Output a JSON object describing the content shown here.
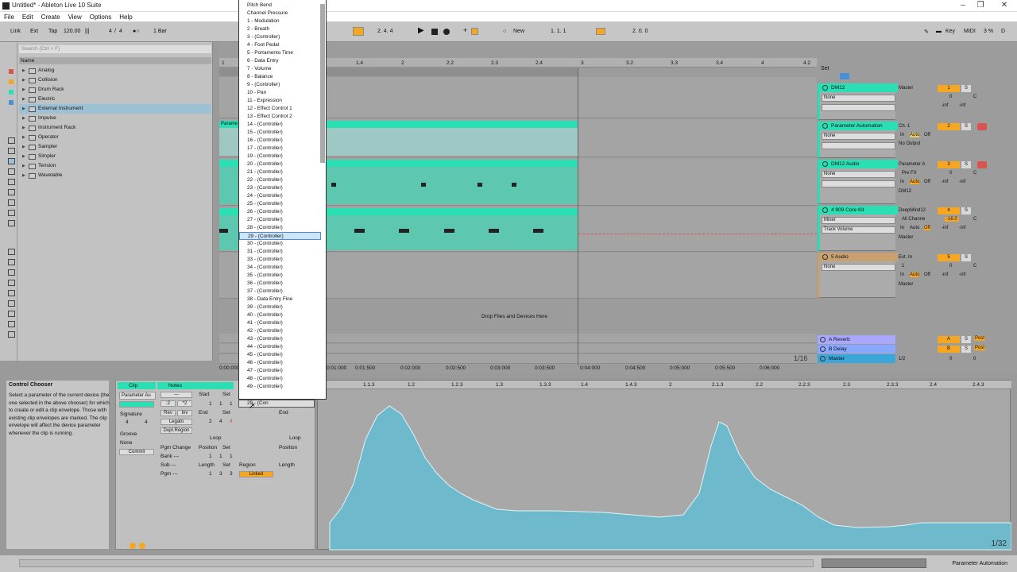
{
  "window": {
    "title": "Untitled* - Ableton Live 10 Suite"
  },
  "menu": [
    "File",
    "Edit",
    "Create",
    "View",
    "Options",
    "Help"
  ],
  "transport": {
    "link": "Link",
    "ext": "Ext",
    "tap": "Tap",
    "tempo": "120.00",
    "meter_num": "4",
    "meter_den": "4",
    "quantize": "1 Bar",
    "pos": "2.  4.  4",
    "new": "New",
    "loop_start": "1.  1.  1",
    "loop_len": "2.  0.  0",
    "key": "Key",
    "midi": "MIDI",
    "cpu": "3 %",
    "d": "D"
  },
  "browser": {
    "search_placeholder": "Search (Ctrl + F)",
    "name_header": "Name",
    "items": [
      "Analog",
      "Collision",
      "Drum Rack",
      "Electric",
      "External Instrument",
      "Impulse",
      "Instrument Rack",
      "Operator",
      "Sampler",
      "Simpler",
      "Tension",
      "Wavetable"
    ],
    "selected": "External Instrument"
  },
  "arrangement": {
    "ruler": [
      "1",
      "1.4",
      "2",
      "2.2",
      "2.3",
      "2.4",
      "3",
      "3.2",
      "3.3",
      "3.4",
      "4",
      "4.2"
    ],
    "times": [
      "0:00:000",
      "0:01:000",
      "0:01:500",
      "0:02:000",
      "0:02:500",
      "0:03:000",
      "0:03:500",
      "0:04:000",
      "0:04:500",
      "0:05:000",
      "0:05:500",
      "0:06:000"
    ],
    "drop_text": "Drop Files and Devices Here",
    "zoom": "1/16",
    "clip_label": "Parame"
  },
  "mixer": {
    "set": "Set",
    "tracks": [
      {
        "name": "DM12",
        "chooser": "None",
        "routing": "Master",
        "num": "1",
        "vol": "0",
        "pan": "C",
        "l": "-inf",
        "r": "-inf"
      },
      {
        "name": "Parameter Automation",
        "chooser": "None",
        "ch": "Ch. 1",
        "in": "In",
        "auto": "Auto",
        "off": "Off",
        "out": "No Output",
        "num": "2"
      },
      {
        "name": "DM12 Audio",
        "chooser": "None",
        "routing": "Parameter A",
        "prefx": "Pre FX",
        "in": "In",
        "auto": "Auto",
        "off": "Off",
        "out": "DM12",
        "num": "3",
        "vol": "0",
        "pan": "C",
        "l": "-inf",
        "r": "-inf"
      },
      {
        "name": "4 909 Core Kit",
        "chooser": "Mixer",
        "chooser2": "Track Volume",
        "routing": "DeepMind12",
        "allch": "All Channe",
        "in": "In",
        "auto": "Auto",
        "off": "Off",
        "out": "Master",
        "num": "4",
        "vol": "-16.0",
        "pan": "C",
        "l": "-inf",
        "r": "-inf"
      },
      {
        "name": "5 Audio",
        "chooser": "None",
        "routing": "Ext. In",
        "ch": "1",
        "in": "In",
        "auto": "Auto",
        "off": "Off",
        "out": "Master",
        "num": "5",
        "vol": "0",
        "pan": "C",
        "l": "-inf",
        "r": "-inf"
      }
    ],
    "returns": [
      {
        "name": "A Reverb",
        "letter": "A",
        "post": "Post"
      },
      {
        "name": "B Delay",
        "letter": "B",
        "post": "Post"
      }
    ],
    "master": {
      "name": "Master",
      "routing": "1/2",
      "vol": "0",
      "pan": "0"
    }
  },
  "dropdown": {
    "items": [
      "Pitch Bend",
      "Channel Pressure",
      "1 - Modulation",
      "2 - Breath",
      "3 - (Controller)",
      "4 - Foot Pedal",
      "5 - Portamento Time",
      "6 - Data Entry",
      "7 - Volume",
      "8 - Balance",
      "9 - (Controller)",
      "10 - Pan",
      "11 - Expression",
      "12 - Effect Control 1",
      "13 - Effect Control 2",
      "14 - (Controller)",
      "15 - (Controller)",
      "16 - (Controller)",
      "17 - (Controller)",
      "19 - (Controller)",
      "20 - (Controller)",
      "21 - (Controller)",
      "22 - (Controller)",
      "23 - (Controller)",
      "24 - (Controller)",
      "25 - (Controller)",
      "26 - (Controller)",
      "27 - (Controller)",
      "28 - (Controller)",
      "29 - (Controller)",
      "30 - (Controller)",
      "31 - (Controller)",
      "33 - (Controller)",
      "34 - (Controller)",
      "35 - (Controller)",
      "36 - (Controller)",
      "37 - (Controller)",
      "38 - Data Entry Fine",
      "39 - (Controller)",
      "40 - (Controller)",
      "41 - (Controller)",
      "42 - (Controller)",
      "43 - (Controller)",
      "44 - (Controller)",
      "45 - (Controller)",
      "46 - (Controller)",
      "47 - (Controller)",
      "48 - (Controller)",
      "49 - (Controller)"
    ],
    "selected": "29 - (Controller)",
    "current": "29 - (Con"
  },
  "info": {
    "heading": "Control Chooser",
    "body": "Select a parameter of the current device (the one selected in the above chooser) for which to create or edit a clip envelope. Those with existing clip envelopes are marked. The clip envelope will affect the device parameter whenever the clip is running."
  },
  "clip_view": {
    "clip_header": "Clip",
    "notes_header": "Notes",
    "clip_name": "Parameter Au",
    "signature": "Signature",
    "sig_num": "4",
    "sig_den": "4",
    "groove": "Groove",
    "groove_val": "None",
    "commit": "Commit",
    "start": "Start",
    "set": "Set",
    "end": "End",
    "loop": "Loop",
    "position": "Position",
    "length": "Length",
    "start_val": [
      "1",
      "1",
      "1"
    ],
    "end_val": [
      "2",
      "4",
      "4"
    ],
    "pos_val": [
      "1",
      "1",
      "1"
    ],
    "len_val": [
      "1",
      "3",
      "3"
    ],
    "pgm_change": "Pgm Change",
    "bank": "Bank ---",
    "sub": "Sub ---",
    "pgm": "Pgm ---",
    "rev": "Rev",
    "inv": "Inv",
    "legato": "Legato",
    "dupl": "Dupl.Region",
    "region": "Region",
    "linked": "Linked",
    "half": ":2",
    "double": "*2"
  },
  "envelope": {
    "ruler": [
      "1.1.3",
      "1.2",
      "1.2.3",
      "1.3",
      "1.3.3",
      "1.4",
      "1.4.3",
      "2",
      "2.1.3",
      "2.2",
      "2.2.3",
      "2.3",
      "2.3.3",
      "2.4",
      "2.4.3"
    ],
    "zoom": "1/32"
  },
  "status": {
    "right": "Parameter Automation"
  },
  "colors": {
    "accent": "#29dfb3",
    "orange": "#f5a623",
    "clip": "#5ec7b0",
    "envelope": "#6fb9cc"
  }
}
